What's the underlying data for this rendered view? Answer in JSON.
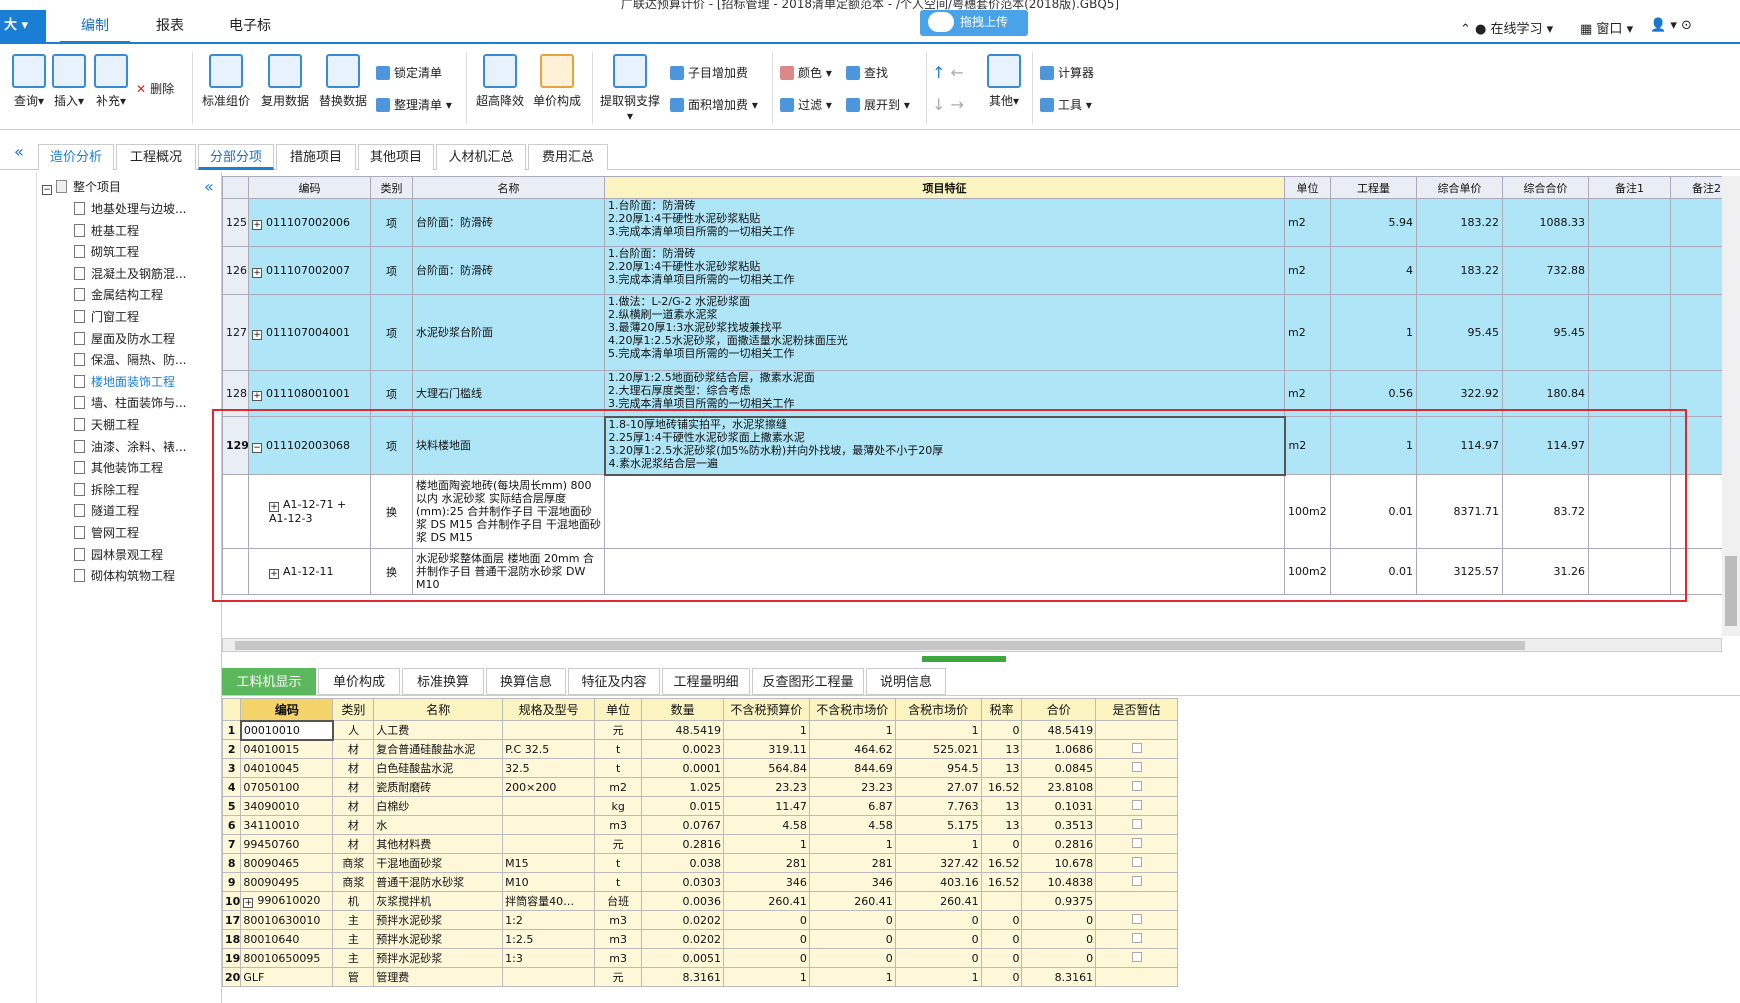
{
  "window": {
    "title": "广联达预算计价 - [招标管理 - 2018清单定额范本 - /个人空间/粤穗套价范本(2018版).GBQ5]"
  },
  "menu": {
    "app_label": "大",
    "tabs": [
      "编制",
      "报表",
      "电子标"
    ],
    "upload_label": "拖拽上传",
    "right": [
      "在线学习",
      "窗口"
    ]
  },
  "toolbar": {
    "big": [
      "查询",
      "插入",
      "补充",
      "标准组价",
      "复用数据",
      "替换数据",
      "超高降效",
      "单价构成",
      "提取钢支撑",
      "其他"
    ],
    "small": {
      "delete": "删除",
      "lock": "锁定清单",
      "sort": "整理清单",
      "sub_add": "子目增加费",
      "area_add": "面积增加费",
      "color": "颜色",
      "find": "查找",
      "filter": "过滤",
      "expand": "展开到",
      "calculator": "计算器",
      "tools": "工具"
    }
  },
  "tabs": [
    "造价分析",
    "工程概况",
    "分部分项",
    "措施项目",
    "其他项目",
    "人材机汇总",
    "费用汇总"
  ],
  "tree": {
    "root": "整个项目",
    "items": [
      "地基处理与边坡...",
      "桩基工程",
      "砌筑工程",
      "混凝土及钢筋混...",
      "金属结构工程",
      "门窗工程",
      "屋面及防水工程",
      "保温、隔热、防...",
      "楼地面装饰工程",
      "墙、柱面装饰与...",
      "天棚工程",
      "油漆、涂料、裱...",
      "其他装饰工程",
      "拆除工程",
      "隧道工程",
      "管网工程",
      "园林景观工程",
      "砌体构筑物工程"
    ]
  },
  "grid": {
    "headers": [
      "编码",
      "类别",
      "名称",
      "项目特征",
      "单位",
      "工程量",
      "综合单价",
      "综合合价",
      "备注1",
      "备注2"
    ],
    "rows": [
      {
        "no": "125",
        "code": "011107002006",
        "type": "项",
        "name": "台阶面：防滑砖",
        "feat": "1.台阶面：防滑砖\n2.20厚1:4干硬性水泥砂浆粘贴\n3.完成本清单项目所需的一切相关工作",
        "unit": "m2",
        "qty": "5.94",
        "price": "183.22",
        "total": "1088.33"
      },
      {
        "no": "126",
        "code": "011107002007",
        "type": "项",
        "name": "台阶面：防滑砖",
        "feat": "1.台阶面：防滑砖\n2.20厚1:4干硬性水泥砂浆粘贴\n3.完成本清单项目所需的一切相关工作",
        "unit": "m2",
        "qty": "4",
        "price": "183.22",
        "total": "732.88"
      },
      {
        "no": "127",
        "code": "011107004001",
        "type": "项",
        "name": "水泥砂浆台阶面",
        "feat": "1.做法：L-2/G-2 水泥砂浆面\n2.纵横刷一道素水泥浆\n3.最薄20厚1:3水泥砂浆找坡兼找平\n4.20厚1:2.5水泥砂浆，面撒适量水泥粉抹面压光\n5.完成本清单项目所需的一切相关工作",
        "unit": "m2",
        "qty": "1",
        "price": "95.45",
        "total": "95.45"
      },
      {
        "no": "128",
        "code": "011108001001",
        "type": "项",
        "name": "大理石门槛线",
        "feat": "1.20厚1:2.5地面砂浆结合层，撒素水泥面\n2.大理石厚度类型：综合考虑\n3.完成本清单项目所需的一切相关工作",
        "unit": "m2",
        "qty": "0.56",
        "price": "322.92",
        "total": "180.84"
      },
      {
        "no": "129",
        "code": "011102003068",
        "type": "项",
        "name": "块料楼地面",
        "feat": "1.8-10厚地砖铺实拍平，水泥浆擦缝\n2.25厚1:4干硬性水泥砂浆面上撒素水泥\n3.20厚1:2.5水泥砂浆(加5%防水粉)并向外找坡，最薄处不小于20厚\n4.素水泥浆结合层一遍",
        "unit": "m2",
        "qty": "1",
        "price": "114.97",
        "total": "114.97"
      },
      {
        "no": "",
        "code": "A1-12-71 + A1-12-3",
        "type": "换",
        "name": "楼地面陶瓷地砖(每块周长mm) 800以内 水泥砂浆  实际结合层厚度(mm):25  合并制作子目 干混地面砂浆 DS M15  合并制作子目 干混地面砂浆 DS M15",
        "feat": "",
        "unit": "100m2",
        "qty": "0.01",
        "price": "8371.71",
        "total": "83.72"
      },
      {
        "no": "",
        "code": "A1-12-11",
        "type": "换",
        "name": "水泥砂浆整体面层 楼地面 20mm 合并制作子目 普通干混防水砂浆 DW M10",
        "feat": "",
        "unit": "100m2",
        "qty": "0.01",
        "price": "3125.57",
        "total": "31.26"
      }
    ]
  },
  "bottom_tabs": [
    "工料机显示",
    "单价构成",
    "标准换算",
    "换算信息",
    "特征及内容",
    "工程量明细",
    "反查图形工程量",
    "说明信息"
  ],
  "resources": {
    "headers": [
      "编码",
      "类别",
      "名称",
      "规格及型号",
      "单位",
      "数量",
      "不含税预算价",
      "不含税市场价",
      "含税市场价",
      "税率",
      "合价",
      "是否暂估"
    ],
    "rows": [
      [
        "1",
        "00010010",
        "人",
        "人工费",
        "",
        "元",
        "48.5419",
        "1",
        "1",
        "1",
        "0",
        "48.5419",
        ""
      ],
      [
        "2",
        "04010015",
        "材",
        "复合普通硅酸盐水泥",
        "P.C 32.5",
        "t",
        "0.0023",
        "319.11",
        "464.62",
        "525.021",
        "13",
        "1.0686",
        "cb"
      ],
      [
        "3",
        "04010045",
        "材",
        "白色硅酸盐水泥",
        "32.5",
        "t",
        "0.0001",
        "564.84",
        "844.69",
        "954.5",
        "13",
        "0.0845",
        "cb"
      ],
      [
        "4",
        "07050100",
        "材",
        "瓷质耐磨砖",
        "200×200",
        "m2",
        "1.025",
        "23.23",
        "23.23",
        "27.07",
        "16.52",
        "23.8108",
        "cb"
      ],
      [
        "5",
        "34090010",
        "材",
        "白棉纱",
        "",
        "kg",
        "0.015",
        "11.47",
        "6.87",
        "7.763",
        "13",
        "0.1031",
        "cb"
      ],
      [
        "6",
        "34110010",
        "材",
        "水",
        "",
        "m3",
        "0.0767",
        "4.58",
        "4.58",
        "5.175",
        "13",
        "0.3513",
        "cb"
      ],
      [
        "7",
        "99450760",
        "材",
        "其他材料费",
        "",
        "元",
        "0.2816",
        "1",
        "1",
        "1",
        "0",
        "0.2816",
        "cb"
      ],
      [
        "8",
        "80090465",
        "商浆",
        "干混地面砂浆",
        "M15",
        "t",
        "0.038",
        "281",
        "281",
        "327.42",
        "16.52",
        "10.678",
        "cb"
      ],
      [
        "9",
        "80090495",
        "商浆",
        "普通干混防水砂浆",
        "M10",
        "t",
        "0.0303",
        "346",
        "346",
        "403.16",
        "16.52",
        "10.4838",
        "cb"
      ],
      [
        "10",
        "990610020",
        "机",
        "灰浆搅拌机",
        "拌筒容量40…",
        "台班",
        "0.0036",
        "260.41",
        "260.41",
        "260.41",
        "",
        "0.9375",
        ""
      ],
      [
        "17",
        "80010630010",
        "主",
        "预拌水泥砂浆",
        "1:2",
        "m3",
        "0.0202",
        "0",
        "0",
        "0",
        "0",
        "0",
        "cb"
      ],
      [
        "18",
        "80010640",
        "主",
        "预拌水泥砂浆",
        "1:2.5",
        "m3",
        "0.0202",
        "0",
        "0",
        "0",
        "0",
        "0",
        "cb"
      ],
      [
        "19",
        "80010650095",
        "主",
        "预拌水泥砂浆",
        "1:3",
        "m3",
        "0.0051",
        "0",
        "0",
        "0",
        "0",
        "0",
        "cb"
      ],
      [
        "20",
        "GLF",
        "管",
        "管理费",
        "",
        "元",
        "8.3161",
        "1",
        "1",
        "1",
        "0",
        "8.3161",
        ""
      ]
    ]
  }
}
